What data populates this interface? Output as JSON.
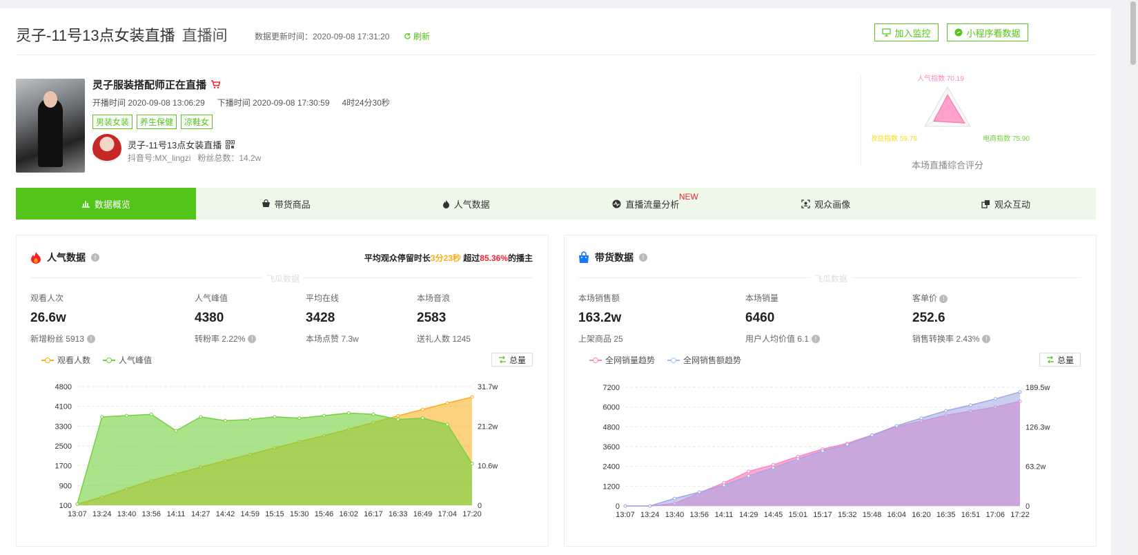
{
  "header": {
    "title": "灵子-11号13点女装直播",
    "subtitle": "直播间",
    "update_label": "数据更新时间：2020-09-08 17:31:20",
    "refresh_label": "刷新",
    "monitor_btn": "加入监控",
    "miniapp_btn": "小程序看数据"
  },
  "room": {
    "title": "灵子服装搭配师正在直播",
    "start": "开播时间 2020-09-08 13:06:29",
    "end": "下播时间 2020-09-08 17:30:59",
    "duration": "4时24分30秒",
    "tags": [
      "男装女装",
      "养生保健",
      "凉鞋女"
    ],
    "account_name": "灵子-11号13点女装直播",
    "douyin_id": "抖音号:MX_lingzi",
    "fans": "粉丝总数：14.2w"
  },
  "radar": {
    "label_popularity": "人气指数 70.19",
    "label_revenue": "收益指数 59.79",
    "label_ecommerce": "电商指数 75.90",
    "caption": "本场直播综合评分",
    "values": {
      "popularity": 70.19,
      "revenue": 59.79,
      "ecommerce": 75.9
    },
    "colors": {
      "popularity": "#ff85c0",
      "revenue": "#fadb14",
      "ecommerce": "#73d13d"
    }
  },
  "tabs": [
    {
      "label": "数据概览",
      "icon": "bar-chart-icon",
      "active": true
    },
    {
      "label": "带货商品",
      "icon": "basket-icon"
    },
    {
      "label": "人气数据",
      "icon": "flame-icon"
    },
    {
      "label": "直播流量分析",
      "icon": "pulse-icon",
      "badge": "NEW"
    },
    {
      "label": "观众画像",
      "icon": "portrait-icon"
    },
    {
      "label": "观众互动",
      "icon": "interaction-icon"
    }
  ],
  "popularity": {
    "title": "人气数据",
    "note_prefix": "平均观众停留时长",
    "note_time": "3分23秒",
    "note_mid": "超过",
    "note_pct": "85.36%",
    "note_suffix": "的播主",
    "watermark": "飞瓜数据",
    "stats": [
      {
        "label": "观看人次",
        "value": "26.6w",
        "sub": "新增粉丝 5913"
      },
      {
        "label": "人气峰值",
        "value": "4380",
        "sub": "转粉率 2.22%"
      },
      {
        "label": "平均在线",
        "value": "3428",
        "sub": "本场点赞 7.3w"
      },
      {
        "label": "本场音浪",
        "value": "2583",
        "sub": "送礼人数 1245"
      }
    ],
    "legend": [
      "观看人数",
      "人气峰值"
    ],
    "total_btn": "总量"
  },
  "sales": {
    "title": "带货数据",
    "watermark": "飞瓜数据",
    "stats": [
      {
        "label": "本场销售额",
        "value": "163.2w",
        "sub": "上架商品 25"
      },
      {
        "label": "本场销量",
        "value": "6460",
        "sub": "用户人均价值 6.1"
      },
      {
        "label": "客单价",
        "value": "252.6",
        "sub": "销售转换率 2.43%"
      }
    ],
    "legend": [
      "全网销量趋势",
      "全网销售额趋势"
    ],
    "total_btn": "总量"
  },
  "chart_data": [
    {
      "type": "area",
      "x": [
        "13:07",
        "13:24",
        "13:40",
        "13:56",
        "14:11",
        "14:27",
        "14:42",
        "14:59",
        "15:15",
        "15:30",
        "15:46",
        "16:02",
        "16:17",
        "16:33",
        "16:49",
        "17:04",
        "17:20"
      ],
      "y_left_ticks": [
        "4800",
        "4100",
        "3300",
        "2500",
        "1700",
        "900",
        "100"
      ],
      "y_left_range": [
        100,
        4800
      ],
      "y_right_ticks": [
        "31.7w",
        "21.2w",
        "10.6w",
        "0"
      ],
      "y_right_range": [
        0,
        31.7
      ],
      "series": [
        {
          "name": "观看人数",
          "axis": "right",
          "color": "#faad14",
          "values": [
            0.3,
            2.2,
            4.4,
            6.6,
            8.4,
            10.2,
            11.9,
            13.6,
            15.3,
            17.0,
            18.6,
            20.3,
            22.1,
            23.9,
            25.6,
            27.3,
            28.9
          ]
        },
        {
          "name": "人气峰值",
          "axis": "left",
          "color": "#73d13d",
          "values": [
            150,
            3600,
            3650,
            3700,
            3050,
            3600,
            3450,
            3500,
            3600,
            3550,
            3650,
            3750,
            3700,
            3500,
            3550,
            3300,
            1750
          ]
        }
      ]
    },
    {
      "type": "area",
      "x": [
        "13:07",
        "13:24",
        "13:40",
        "13:56",
        "14:11",
        "14:29",
        "14:45",
        "15:01",
        "15:17",
        "15:32",
        "15:48",
        "16:04",
        "16:20",
        "16:35",
        "16:51",
        "17:06",
        "17:22"
      ],
      "y_left_ticks": [
        "7200",
        "6000",
        "4800",
        "3600",
        "2400",
        "1200",
        "0"
      ],
      "y_left_range": [
        0,
        7200
      ],
      "y_right_ticks": [
        "189.5w",
        "126.3w",
        "63.2w",
        "0"
      ],
      "y_right_range": [
        0,
        189.5
      ],
      "series": [
        {
          "name": "全网销量趋势",
          "axis": "left",
          "color": "#ff85c0",
          "values": [
            0,
            0,
            150,
            800,
            1400,
            2100,
            2500,
            3000,
            3450,
            3800,
            4300,
            4800,
            5150,
            5500,
            5750,
            6000,
            6350
          ]
        },
        {
          "name": "全网销售额趋势",
          "axis": "right",
          "color": "#9ea8e6",
          "values": [
            0,
            0,
            12,
            22,
            33,
            48,
            61,
            75,
            88,
            98,
            113,
            128,
            140,
            152,
            161,
            171,
            182
          ]
        }
      ]
    }
  ]
}
